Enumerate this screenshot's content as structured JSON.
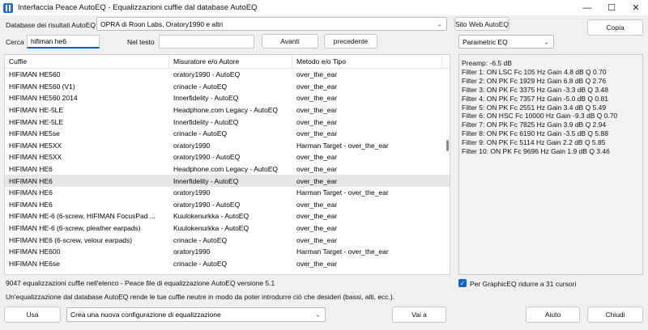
{
  "window": {
    "title": "Interfaccia Peace AutoEQ - Equalizzazioni cuffie dal database AutoEQ",
    "minimize_glyph": "—",
    "maximize_glyph": "☐",
    "close_glyph": "✕"
  },
  "database": {
    "label": "Database dei risultati AutoEQ",
    "selected": "OPRA di Roon Labs, Oratory1990 e altri",
    "site_button": "Sito Web AutoEQ"
  },
  "copy_button": "Copia",
  "search": {
    "label": "Cerca",
    "value": "hifiman he6",
    "text_label": "Nel testo",
    "text_value": "",
    "next_button": "Avanti",
    "prev_button": "precedente"
  },
  "format_select": "Parametric EQ",
  "table": {
    "columns": [
      "Cuffie",
      "Misuratore e/o Autore",
      "Metodo e/o Tipo"
    ],
    "selected_index": 9,
    "rows": [
      [
        "HIFIMAN HE560",
        "oratory1990 - AutoEQ",
        "over_the_ear"
      ],
      [
        "HIFIMAN HE560 (V1)",
        "crinacle - AutoEQ",
        "over_the_ear"
      ],
      [
        "HIFIMAN HE560 2014",
        "Innerfidelity - AutoEQ",
        "over_the_ear"
      ],
      [
        "HIFIMAN HE-5LE",
        "Headphone.com Legacy - AutoEQ",
        "over_the_ear"
      ],
      [
        "HIFIMAN HE-5LE",
        "Innerfidelity - AutoEQ",
        "over_the_ear"
      ],
      [
        "HIFIMAN HE5se",
        "crinacle - AutoEQ",
        "over_the_ear"
      ],
      [
        "HIFIMAN HE5XX",
        "oratory1990",
        "Harman Target - over_the_ear"
      ],
      [
        "HIFIMAN HE5XX",
        "oratory1990 - AutoEQ",
        "over_the_ear"
      ],
      [
        "HIFIMAN HE6",
        "Headphone.com Legacy - AutoEQ",
        "over_the_ear"
      ],
      [
        "HIFIMAN HE6",
        "Innerfidelity - AutoEQ",
        "over_the_ear"
      ],
      [
        "HIFIMAN HE6",
        "oratory1990",
        "Harman Target - over_the_ear"
      ],
      [
        "HIFIMAN HE6",
        "oratory1990 - AutoEQ",
        "over_the_ear"
      ],
      [
        "HIFIMAN HE-6 (6-screw, HIFIMAN FocusPad ...",
        "Kuulokenurkka - AutoEQ",
        "over_the_ear"
      ],
      [
        "HIFIMAN HE-6 (6-screw, pleather earpads)",
        "Kuulokenurkka - AutoEQ",
        "over_the_ear"
      ],
      [
        "HIFIMAN HE6 (6-screw, velour earpads)",
        "crinacle - AutoEQ",
        "over_the_ear"
      ],
      [
        "HIFIMAN HE600",
        "oratory1990",
        "Harman Target - over_the_ear"
      ],
      [
        "HIFIMAN HE6se",
        "crinacle - AutoEQ",
        "over_the_ear"
      ]
    ]
  },
  "filters": [
    "Preamp: -6.5 dB",
    "Filter 1: ON LSC Fc 105 Hz Gain 4.8 dB Q 0.70",
    "Filter 2: ON PK Fc 1929 Hz Gain 6.8 dB Q 2.76",
    "Filter 3: ON PK Fc 3375 Hz Gain -3.3 dB Q 3.48",
    "Filter 4: ON PK Fc 7357 Hz Gain -5.0 dB Q 0.81",
    "Filter 5: ON PK Fc 2551 Hz Gain 3.4 dB Q 5.49",
    "Filter 6: ON HSC Fc 10000 Hz Gain -9.3 dB Q 0.70",
    "Filter 7: ON PK Fc 7825 Hz Gain 3.9 dB Q 2.94",
    "Filter 8: ON PK Fc 6190 Hz Gain -3.5 dB Q 5.88",
    "Filter 9: ON PK Fc 5114 Hz Gain 2.2 dB Q 5.85",
    "Filter 10: ON PK Fc 9696 Hz Gain 1.9 dB Q 3.46"
  ],
  "status": {
    "count_line": "9047 equalizzazioni cuffie nell'elenco - Peace file di equalizzazione AutoEQ versione 5.1",
    "info_line": "Un'equalizzazione dal database AutoEQ rende le tue cuffie neutre in modo da poter introdurre ciò che desideri (bassi, alti, ecc.)."
  },
  "graphiceq": {
    "checked": true,
    "label": "Per GraphicEQ ridurre a 31 cursori"
  },
  "bottom": {
    "use_button": "Usa",
    "action_select": "Crea una nuova configurazione di equalizzazione",
    "go_button": "Vai a",
    "help_button": "Aiuto",
    "close_button": "Chiudi"
  },
  "colors": {
    "accent": "#0a64d6",
    "selection": "#e6e6e6"
  }
}
